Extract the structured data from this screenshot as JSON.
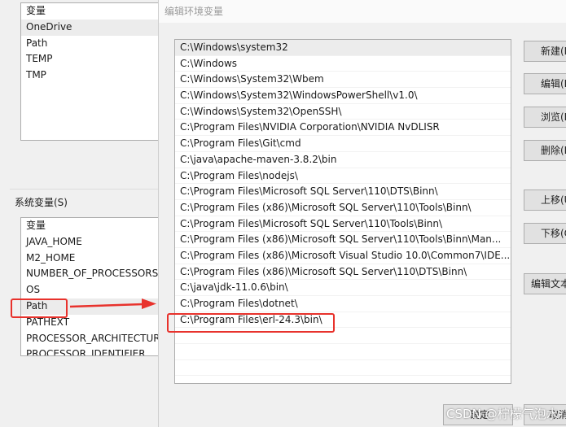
{
  "user_vars": {
    "items": [
      "变量",
      "OneDrive",
      "Path",
      "TEMP",
      "TMP"
    ]
  },
  "system_vars": {
    "label": "系统变量(S)",
    "items": [
      "变量",
      "JAVA_HOME",
      "M2_HOME",
      "NUMBER_OF_PROCESSORS",
      "OS",
      "Path",
      "PATHEXT",
      "PROCESSOR_ARCHITECTURE",
      "PROCESSOR_IDENTIFIER"
    ]
  },
  "dialog": {
    "title": "编辑环境变量",
    "paths": [
      "C:\\Windows\\system32",
      "C:\\Windows",
      "C:\\Windows\\System32\\Wbem",
      "C:\\Windows\\System32\\WindowsPowerShell\\v1.0\\",
      "C:\\Windows\\System32\\OpenSSH\\",
      "C:\\Program Files\\NVIDIA Corporation\\NVIDIA NvDLISR",
      "C:\\Program Files\\Git\\cmd",
      "C:\\java\\apache-maven-3.8.2\\bin",
      "C:\\Program Files\\nodejs\\",
      "C:\\Program Files\\Microsoft SQL Server\\110\\DTS\\Binn\\",
      "C:\\Program Files (x86)\\Microsoft SQL Server\\110\\Tools\\Binn\\",
      "C:\\Program Files\\Microsoft SQL Server\\110\\Tools\\Binn\\",
      "C:\\Program Files (x86)\\Microsoft SQL Server\\110\\Tools\\Binn\\Man...",
      "C:\\Program Files (x86)\\Microsoft Visual Studio 10.0\\Common7\\IDE...",
      "C:\\Program Files (x86)\\Microsoft SQL Server\\110\\DTS\\Binn\\",
      "C:\\java\\jdk-11.0.6\\bin\\",
      "C:\\Program Files\\dotnet\\",
      "C:\\Program Files\\erl-24.3\\bin\\",
      "",
      "",
      "",
      ""
    ],
    "buttons": {
      "new": "新建(N)",
      "edit": "编辑(E)",
      "browse": "浏览(B)...",
      "delete": "删除(D)",
      "up": "上移(U)",
      "down": "下移(O)",
      "edit_text": "编辑文本(T)...",
      "ok": "确定",
      "cancel": "取消"
    }
  },
  "watermark": "CSDN @柠檬气泡水-",
  "colors": {
    "highlight": "#e8322c"
  }
}
